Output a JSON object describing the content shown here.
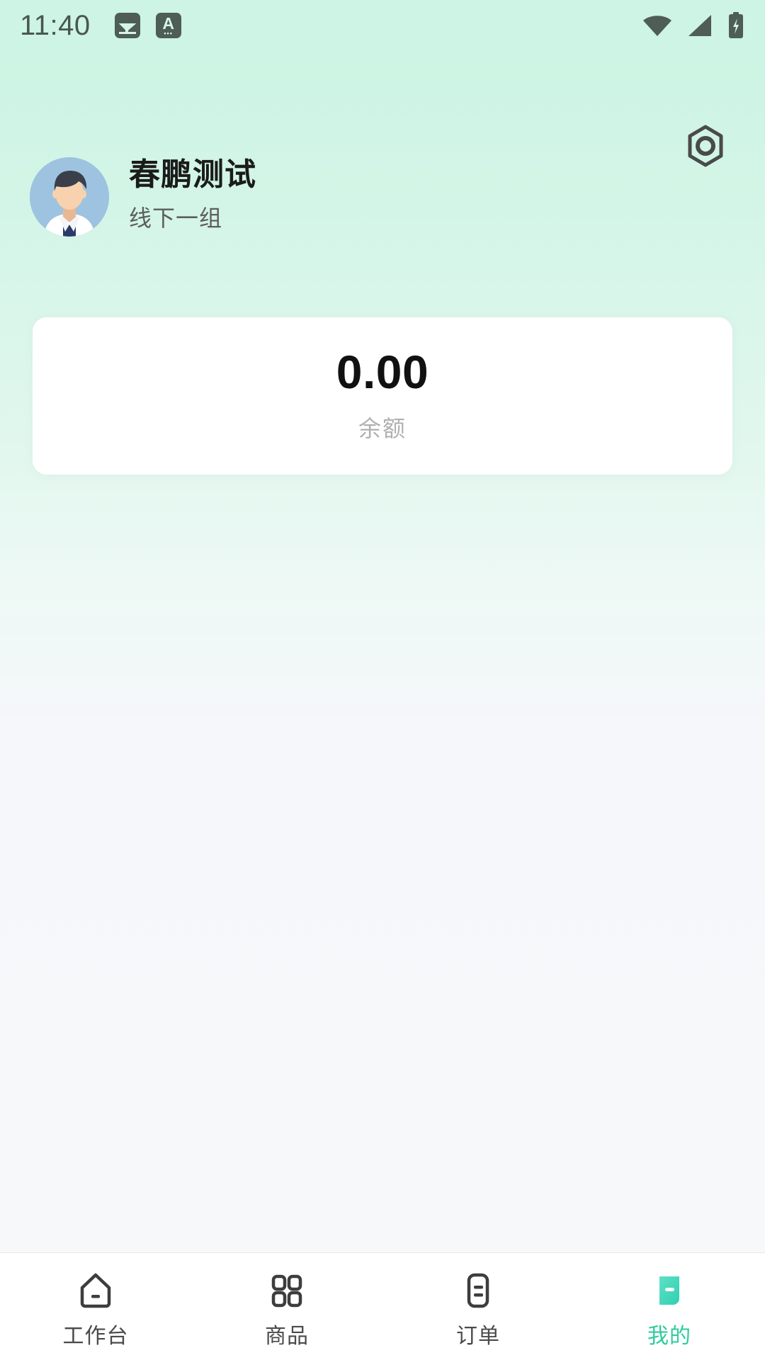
{
  "status_bar": {
    "time": "11:40",
    "left_icons": [
      {
        "name": "image-icon",
        "glyph": "image"
      },
      {
        "name": "input-method-icon",
        "glyph": "A"
      }
    ],
    "right_icons": [
      {
        "name": "wifi-icon",
        "state": "full"
      },
      {
        "name": "cellular-signal-icon",
        "state": "full"
      },
      {
        "name": "battery-charging-icon",
        "state": "charging"
      }
    ]
  },
  "header": {
    "settings_icon": "settings-nut-icon"
  },
  "profile": {
    "avatar_alt": "user-avatar",
    "name": "春鹏测试",
    "group": "线下一组"
  },
  "balance_card": {
    "amount": "0.00",
    "label": "余额"
  },
  "tabbar": {
    "active_index": 3,
    "accent_color": "#2ecc9b",
    "items": [
      {
        "label": "工作台",
        "icon": "home-icon"
      },
      {
        "label": "商品",
        "icon": "grid-icon"
      },
      {
        "label": "订单",
        "icon": "document-icon"
      },
      {
        "label": "我的",
        "icon": "profile-icon"
      }
    ]
  },
  "colors": {
    "background_top": "#cdf4e4",
    "background_bottom": "#f6f8fa",
    "card": "#ffffff",
    "accent": "#2ecc9b",
    "avatar_bg": "#9dc3e0"
  }
}
